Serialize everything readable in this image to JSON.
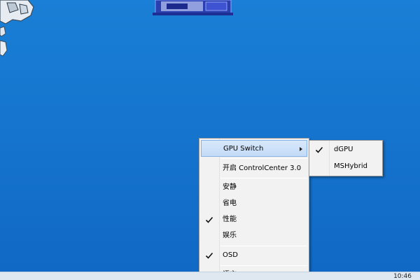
{
  "desktop": {
    "background_color": "#1676cf"
  },
  "taskbar": {
    "clock_text": "10:46"
  },
  "context_menu": {
    "items": [
      {
        "label": "GPU Switch",
        "checked": false,
        "has_submenu": true,
        "highlighted": true
      },
      {
        "label": "开启 ControlCenter 3.0",
        "checked": false,
        "has_submenu": false
      },
      {
        "label": "安静",
        "checked": false,
        "has_submenu": false
      },
      {
        "label": "省电",
        "checked": false,
        "has_submenu": false
      },
      {
        "label": "性能",
        "checked": true,
        "has_submenu": false
      },
      {
        "label": "娱乐",
        "checked": false,
        "has_submenu": false
      },
      {
        "label": "OSD",
        "checked": true,
        "has_submenu": false
      },
      {
        "label": "语言",
        "checked": false,
        "has_submenu": true
      }
    ],
    "highlight_color": "#c3dbf7"
  },
  "gpu_submenu": {
    "items": [
      {
        "label": "dGPU",
        "checked": true
      },
      {
        "label": "MSHybrid",
        "checked": false
      }
    ]
  }
}
